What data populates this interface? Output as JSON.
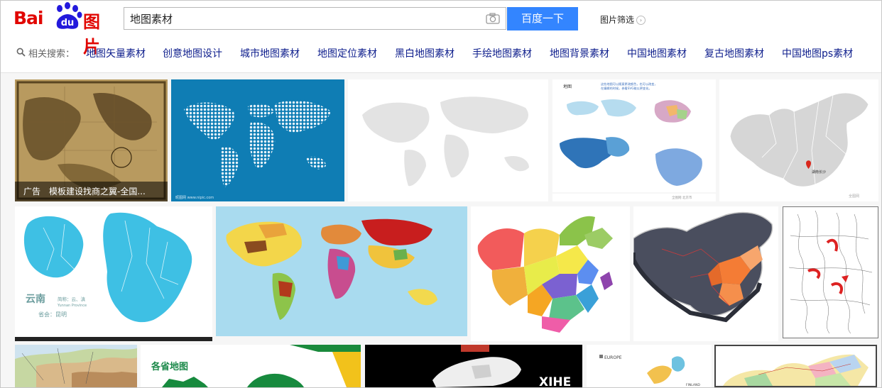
{
  "logo": {
    "bai": "Bai",
    "du": "du",
    "suffix": "图片"
  },
  "search": {
    "query": "地图素材",
    "button": "百度一下",
    "filter": "图片筛选"
  },
  "related": {
    "label": "相关搜索：",
    "links": [
      "地图矢量素材",
      "创意地图设计",
      "城市地图素材",
      "地图定位素材",
      "黑白地图素材",
      "手绘地图素材",
      "地图背景素材",
      "中国地图素材",
      "复古地图素材",
      "中国地图ps素材"
    ]
  },
  "tiles": {
    "ad": {
      "tag": "广告",
      "title": "模板建设找商之翼-全国..."
    },
    "yunnan": {
      "title": "云南",
      "sub1": "简称：云、滇",
      "sub2": "Yunnan Province",
      "sub3": "省会：昆明"
    },
    "provinces": {
      "title": "各省地图"
    },
    "xihe": {
      "brand": "XIHE"
    },
    "europe": {
      "label": "EUROPE",
      "finland": "FINLAND"
    },
    "china_pin": {
      "city": "湖南长沙"
    },
    "world_caption": {
      "title": "地图",
      "note": "这些地图可以随意更改颜色，也可以改变，在编辑的时候，参看SVG能以更变化。"
    }
  },
  "colors": {
    "brand_red": "#e10601",
    "brand_blue": "#2319dc",
    "button_blue": "#3385ff",
    "link": "#0d1d8c"
  }
}
